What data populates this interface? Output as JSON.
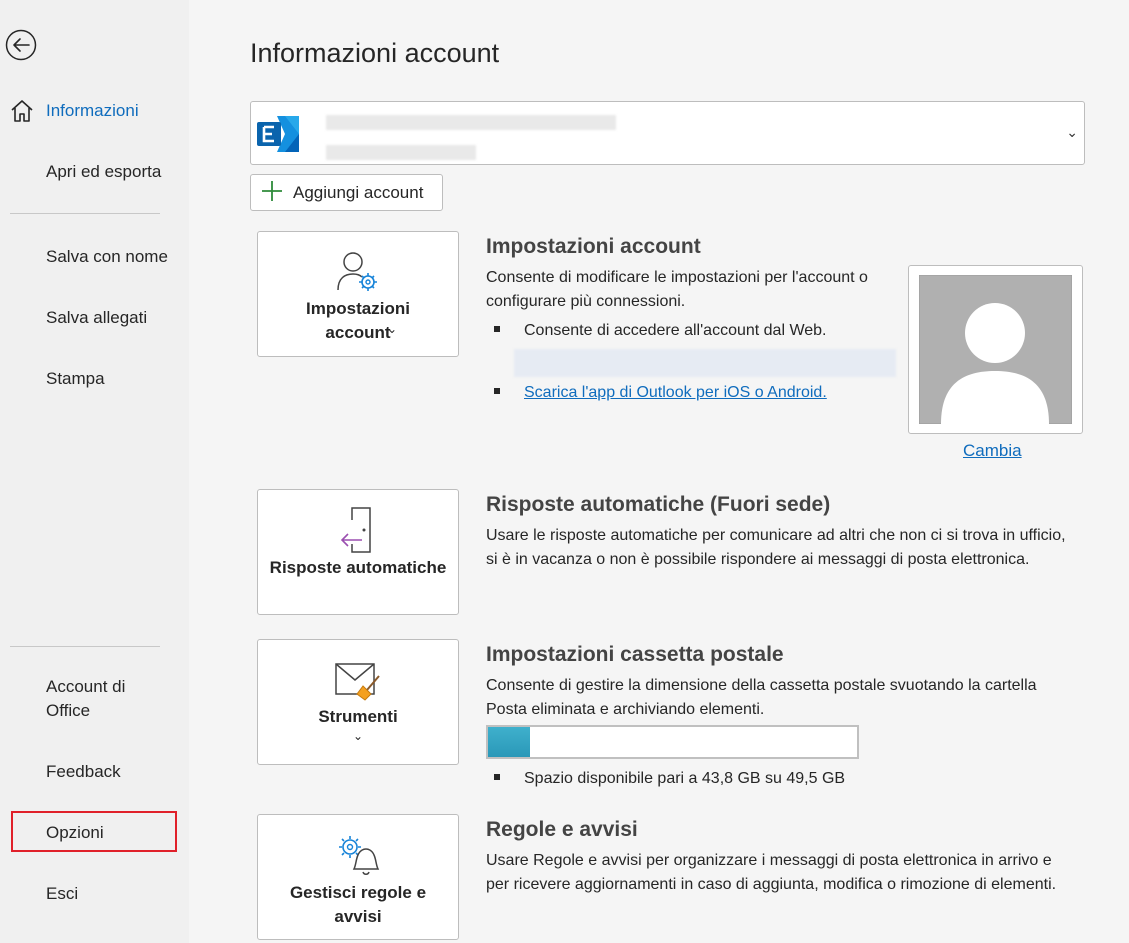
{
  "sidebar": {
    "back_icon": "back-arrow-icon",
    "items": [
      {
        "label": "Informazioni",
        "icon": "home-icon",
        "active": true
      },
      {
        "label": "Apri ed esporta"
      },
      {
        "label": "Salva con nome"
      },
      {
        "label": "Salva allegati"
      },
      {
        "label": "Stampa"
      },
      {
        "label": "Account di Office"
      },
      {
        "label": "Feedback"
      },
      {
        "label": "Opzioni",
        "highlight_color": "#e0202a"
      },
      {
        "label": "Esci"
      }
    ]
  },
  "main": {
    "title": "Informazioni account",
    "account_selector": {
      "icon": "exchange-icon",
      "chevron_icon": "chevron-down-icon"
    },
    "add_account_label": "Aggiungi account",
    "sections": [
      {
        "tile_label": "Impostazioni account",
        "tile_icon": "user-gear-icon",
        "title": "Impostazioni account",
        "description": "Consente di modificare le impostazioni per l'account o configurare più connessioni.",
        "bullets": [
          "Consente di accedere all'account dal Web."
        ],
        "link": "Scarica l'app di Outlook per iOS o Android.",
        "change_label": "Cambia"
      },
      {
        "tile_label": "Risposte automatiche",
        "tile_icon": "door-arrow-icon",
        "title": "Risposte automatiche (Fuori sede)",
        "description": "Usare le risposte automatiche per comunicare ad altri che non ci si trova in ufficio, si è in vacanza o non è possibile rispondere ai messaggi di posta elettronica."
      },
      {
        "tile_label": "Strumenti",
        "tile_icon": "mailbox-broom-icon",
        "title": "Impostazioni cassetta postale",
        "description": "Consente di gestire la dimensione della cassetta postale svuotando la cartella Posta eliminata e archiviando elementi.",
        "storage_used_fraction": 0.115,
        "bullet": "Spazio disponibile pari a 43,8 GB su 49,5 GB"
      },
      {
        "tile_label": "Gestisci regole e avvisi",
        "tile_icon": "gear-bell-icon",
        "title": "Regole e avvisi",
        "description": "Usare Regole e avvisi per organizzare i messaggi di posta elettronica in arrivo e per ricevere aggiornamenti in caso di aggiunta, modifica o rimozione di elementi."
      }
    ]
  },
  "colors": {
    "accent": "#0f6cbd",
    "highlight": "#e0202a",
    "progress": "#2a98b8"
  }
}
